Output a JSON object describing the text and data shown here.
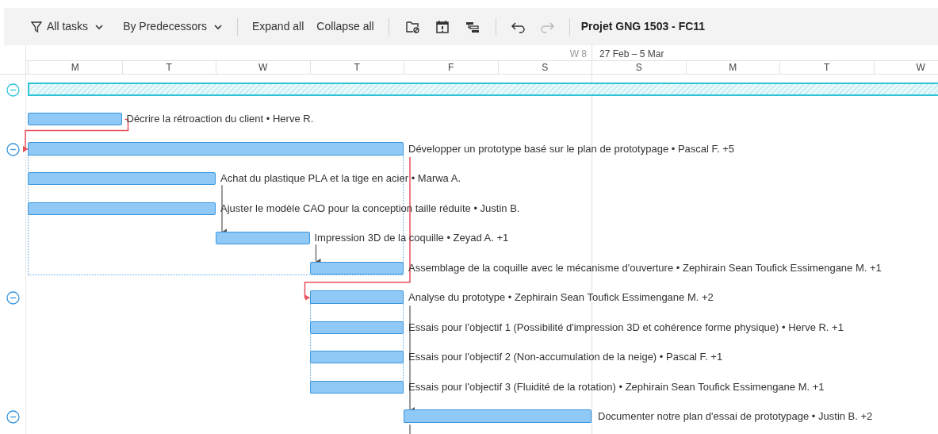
{
  "toolbar": {
    "filter": "All tasks",
    "grouping": "By Predecessors",
    "expand_all": "Expand all",
    "collapse_all": "Collapse all",
    "undo": {
      "disabled": false
    },
    "redo": {
      "disabled": true
    },
    "project_title": "Projet GNG 1503 - FC11"
  },
  "timeline": {
    "weeks": [
      {
        "label": "W 8"
      },
      {
        "label": "27 Feb – 5 Mar"
      }
    ],
    "days": [
      "M",
      "T",
      "W",
      "T",
      "F",
      "S",
      "S",
      "M",
      "T",
      "W"
    ]
  },
  "tasks": [
    {
      "kind": "project",
      "expanded": true
    },
    {
      "kind": "task",
      "label": "Décrire la rétroaction du client • Herve R."
    },
    {
      "kind": "summary",
      "expanded": true,
      "label": "Développer un prototype basé sur le plan de prototypage • Pascal F. +5"
    },
    {
      "kind": "task",
      "label": "Achat du plastique PLA et la tige en acier • Marwa A."
    },
    {
      "kind": "task",
      "label": "Ajuster le modèle CAO pour la conception taille réduite • Justin B."
    },
    {
      "kind": "task",
      "label": "Impression 3D de la coquille • Zeyad A. +1"
    },
    {
      "kind": "task",
      "label": "Assemblage de la coquille avec le mécanisme d'ouverture • Zephirain Sean Toufick Essimengane M. +1"
    },
    {
      "kind": "summary",
      "expanded": true,
      "label": "Analyse du prototype • Zephirain Sean Toufick Essimengane M. +2"
    },
    {
      "kind": "task",
      "label": "Essais pour l'objectif 1 (Possibilité d'impression 3D et cohérence forme physique) • Herve R. +1"
    },
    {
      "kind": "task",
      "label": "Essais pour l'objectif 2 (Non-accumulation de la neige) • Pascal F. +1"
    },
    {
      "kind": "task",
      "label": "Essais pour l'objectif 3 (Fluidité de la rotation) • Zephirain Sean Toufick Essimengane M. +1"
    },
    {
      "kind": "summary",
      "expanded": true,
      "label": "Documenter notre plan d'essai de prototypage • Justin B. +2"
    }
  ]
}
